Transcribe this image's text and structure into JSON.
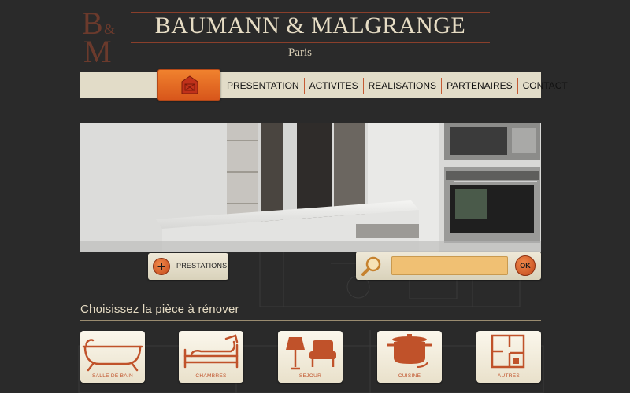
{
  "header": {
    "logo": {
      "b": "B",
      "amp": "&",
      "m": "M"
    },
    "title": "BAUMANN & MALGRANGE",
    "subtitle": "Paris"
  },
  "nav": {
    "home_icon": "house-icon",
    "items": [
      {
        "label": "PRESENTATION"
      },
      {
        "label": "ACTIVITES"
      },
      {
        "label": "REALISATIONS"
      },
      {
        "label": "PARTENAIRES"
      },
      {
        "label": "CONTACT"
      }
    ]
  },
  "hero": {
    "image": "modern-white-kitchen-photo"
  },
  "prestations": {
    "icon": "plus-icon",
    "label": "PRESTATIONS"
  },
  "search": {
    "icon": "magnifier-icon",
    "value": "",
    "placeholder": "",
    "button_label": "OK"
  },
  "rooms": {
    "heading": "Choisissez la pièce à rénover",
    "items": [
      {
        "label": "SALLE DE BAIN",
        "icon": "bathtub-icon"
      },
      {
        "label": "CHAMBRES",
        "icon": "bed-icon"
      },
      {
        "label": "SEJOUR",
        "icon": "lamp-armchair-icon"
      },
      {
        "label": "CUISINE",
        "icon": "cooking-pot-icon"
      },
      {
        "label": "AUTRES",
        "icon": "floor-plan-icon"
      }
    ]
  },
  "colors": {
    "background": "#2a2a2a",
    "accent_orange": "#e0662a",
    "nav_bar": "#e2dcc8",
    "logo_brown": "#6b3a2c",
    "search_field": "#f0c073"
  }
}
